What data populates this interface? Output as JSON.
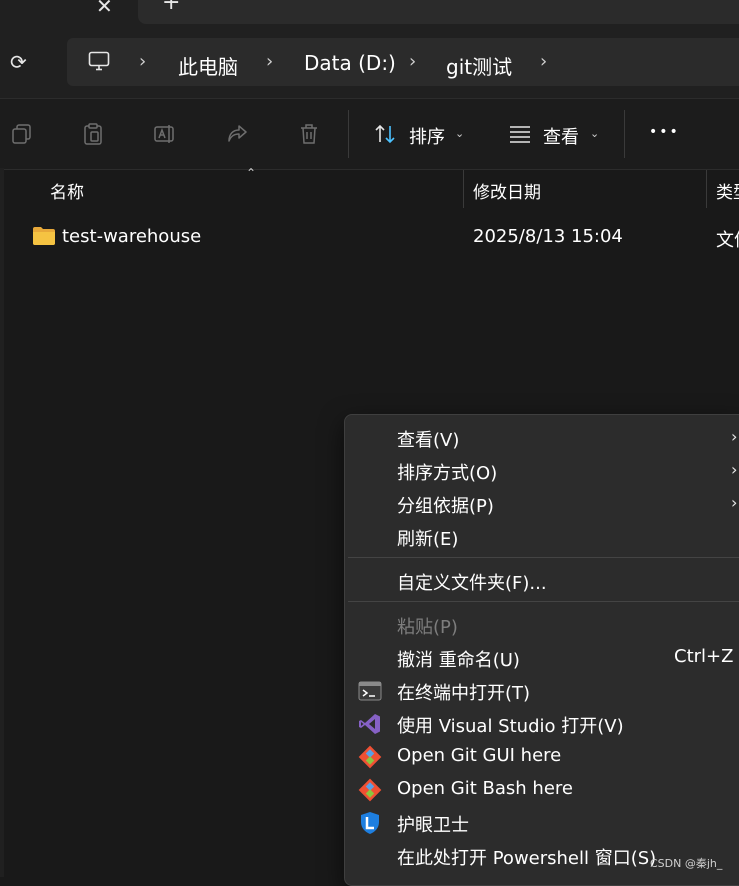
{
  "tabs": {
    "close_glyph": "✕",
    "new_tab_glyph": "+"
  },
  "address": {
    "refresh_glyph": "⟳",
    "chevron": "›",
    "crumbs": [
      "此电脑",
      "Data (D:)",
      "git测试"
    ]
  },
  "toolbar": {
    "sort_label": "排序",
    "view_label": "查看",
    "more_glyph": "•••",
    "caret": "⌄"
  },
  "columns": {
    "name": "名称",
    "modified": "修改日期",
    "type": "类型"
  },
  "files": [
    {
      "name": "test-warehouse",
      "modified": "2025/8/13 15:04",
      "type": "文件夹"
    }
  ],
  "context_menu": {
    "submenu_arrow": "›",
    "items": [
      {
        "label": "查看(V)"
      },
      {
        "label": "排序方式(O)"
      },
      {
        "label": "分组依据(P)"
      },
      {
        "label": "刷新(E)"
      },
      {
        "label": "自定义文件夹(F)..."
      },
      {
        "label": "粘贴(P)"
      },
      {
        "label": "撤消 重命名(U)",
        "shortcut": "Ctrl+Z"
      },
      {
        "label": "在终端中打开(T)"
      },
      {
        "label": "使用 Visual Studio 打开(V)"
      },
      {
        "label": "Open Git GUI here"
      },
      {
        "label": "Open Git Bash here"
      },
      {
        "label": "护眼卫士"
      },
      {
        "label": "在此处打开 Powershell 窗口(S)"
      }
    ]
  },
  "watermark": "CSDN @秦jh_",
  "colors": {
    "background": "#191919",
    "menu_bg": "#2c2c2c",
    "accent_blue": "#4cc2ff",
    "vs_purple": "#8661c5",
    "git_orange": "#f05033",
    "folder_yellow": "#f5c342"
  }
}
